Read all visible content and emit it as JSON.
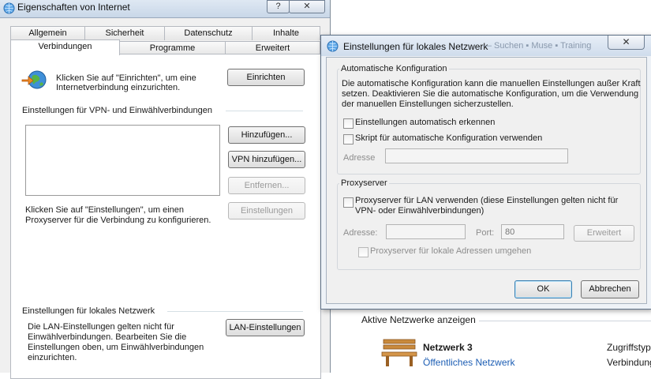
{
  "bg_window": {
    "title": "Eigenschaften von Internet",
    "help_btn": "?",
    "close_btn": "✕",
    "tabs_row1": [
      "Allgemein",
      "Sicherheit",
      "Datenschutz",
      "Inhalte"
    ],
    "tabs_row2": [
      "Verbindungen",
      "Programme",
      "Erweitert"
    ],
    "setup_text_1": "Klicken Sie auf \"Einrichten\", um eine",
    "setup_text_2": "Internetverbindung einzurichten.",
    "setup_btn": "Einrichten",
    "vpn_section": "Einstellungen für VPN- und Einwählverbindungen",
    "add_btn": "Hinzufügen...",
    "add_vpn_btn": "VPN hinzufügen...",
    "remove_btn": "Entfernen...",
    "settings_btn": "Einstellungen",
    "proxy_text_1": "Klicken Sie auf \"Einstellungen\", um einen",
    "proxy_text_2": "Proxyserver für die Verbindung zu konfigurieren.",
    "lan_section": "Einstellungen für lokales Netzwerk",
    "lan_text_1": "Die LAN-Einstellungen gelten nicht für",
    "lan_text_2": "Einwählverbindungen. Bearbeiten Sie die",
    "lan_text_3": "Einstellungen oben, um Einwählverbindungen",
    "lan_text_4": "einzurichten.",
    "lan_btn": "LAN-Einstellungen"
  },
  "dialog": {
    "title": "Einstellungen für lokales Netzwerk",
    "title_bg_text": "— Suchen ▪ Muse ▪ Training",
    "close_btn": "✕",
    "auto_group": "Automatische Konfiguration",
    "auto_desc_1": "Die automatische Konfiguration kann die manuellen Einstellungen außer Kraft",
    "auto_desc_2": "setzen. Deaktivieren Sie die automatische Konfiguration, um die Verwendung",
    "auto_desc_3": "der manuellen Einstellungen sicherzustellen.",
    "auto_detect": "Einstellungen automatisch erkennen",
    "auto_script": "Skript für automatische Konfiguration verwenden",
    "address_label": "Adresse",
    "address_value": "",
    "proxy_group": "Proxyserver",
    "proxy_use_1": "Proxyserver für LAN verwenden (diese Einstellungen gelten nicht für",
    "proxy_use_2": "VPN- oder Einwählverbindungen)",
    "proxy_address_label": "Adresse:",
    "proxy_address_value": "",
    "port_label": "Port:",
    "port_value": "80",
    "advanced_btn": "Erweitert",
    "bypass_local": "Proxyserver für lokale Adressen umgehen",
    "ok_btn": "OK",
    "cancel_btn": "Abbrechen"
  },
  "right_bg": {
    "active_networks": "Aktive Netzwerke anzeigen",
    "network_name": "Netzwerk  3",
    "network_type": "Öffentliches Netzwerk",
    "col_access": "Zugriffstyp",
    "col_connections": "Verbindung"
  },
  "colors": {
    "link": "#1d5eb4",
    "accent": "#3c6ea5"
  }
}
